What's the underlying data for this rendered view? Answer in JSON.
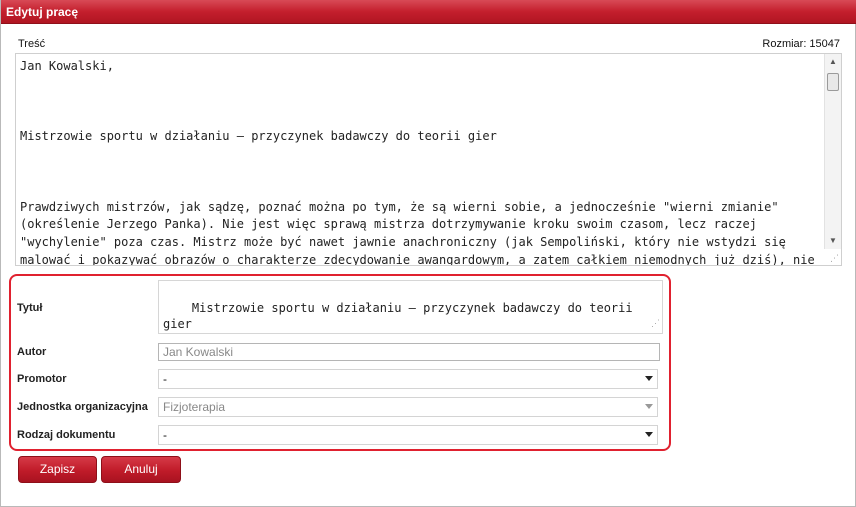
{
  "dialog": {
    "title": "Edytuj pracę",
    "content_label": "Treść",
    "size_label": "Rozmiar:",
    "size_value": "15047",
    "content_text": "Jan Kowalski,\n\n\n\nMistrzowie sportu w działaniu – przyczynek badawczy do teorii gier\n\n\n\nPrawdziwych mistrzów, jak sądzę, poznać można po tym, że są wierni sobie, a jednocześnie \"wierni zmianie\" (określenie Jerzego Panka). Nie jest więc sprawą mistrza dotrzymywanie kroku swoim czasom, lecz raczej \"wychylenie\" poza czas. Mistrz może być nawet jawnie anachroniczny (jak Sempoliński, który nie wstydzi się malować i pokazywać obrazów o charakterze zdecydowanie awangardowym, a zatem całkiem niemodnych już dziś), nie powinien natomiast wykonywać gestów artystycznych o charakterze"
  },
  "form": {
    "title_label": "Tytuł",
    "title_value": "Mistrzowie sportu w działaniu – przyczynek badawczy do teorii gier",
    "author_label": "Autor",
    "author_placeholder": "Jan Kowalski",
    "promotor_label": "Promotor",
    "promotor_value": "-",
    "unit_label": "Jednostka organizacyjna",
    "unit_value": "Fizjoterapia",
    "doctype_label": "Rodzaj dokumentu",
    "doctype_value": "-"
  },
  "buttons": {
    "save": "Zapisz",
    "cancel": "Anuluj"
  },
  "colors": {
    "accent": "#c41f2d",
    "highlight_border": "#e0212f"
  },
  "icons": {
    "scroll_up": "chevron-up-icon",
    "scroll_down": "chevron-down-icon",
    "dropdown": "chevron-down-icon"
  }
}
